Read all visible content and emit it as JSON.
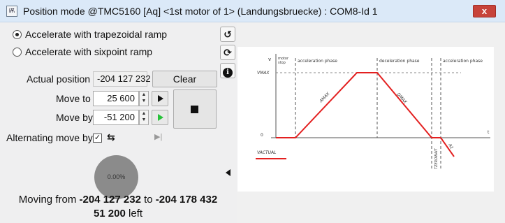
{
  "window": {
    "title": "Position mode @TMC5160 [Aq] <1st motor of 1> (Landungsbruecke) : COM8-Id 1",
    "close_label": "x",
    "icon_text": "Ѭ"
  },
  "ramp": {
    "option1": "Accelerate with trapezoidal ramp",
    "option2": "Accelerate with sixpoint ramp",
    "selected": "trapezoidal"
  },
  "side_buttons": {
    "undo_glyph": "↺",
    "refresh_glyph": "⟳",
    "info_glyph": "i"
  },
  "position": {
    "actual_label": "Actual position",
    "actual_value": "-204 127 232",
    "clear_label": "Clear",
    "move_to_label": "Move to",
    "move_to_value": "25 600",
    "move_by_label": "Move by",
    "move_by_value": "-51 200",
    "spin_up": "▲",
    "spin_down": "▼"
  },
  "alternating": {
    "label": "Alternating move by",
    "checked_glyph": "✓",
    "swap_glyph": "⇆",
    "skip_glyph": "▶|"
  },
  "progress": {
    "percent_label": "0.00%",
    "fraction": 0.0
  },
  "status": {
    "prefix": "Moving from",
    "from": "-204 127 232",
    "to_word": "to",
    "to": "-204 178 432",
    "remaining": "51 200",
    "suffix": "left"
  },
  "diagram": {
    "v_label": "v",
    "motor_stop": "motor\nstop",
    "accel_phase": "acceleration phase",
    "decel_phase": "deceleration phase",
    "accel_phase2": "acceleration phase",
    "vmax": "VMAX",
    "zero": "0",
    "t": "t",
    "amax": "AMAX",
    "dmax": "DMAX",
    "a1": "A1",
    "tzerowait": "TZEROWAIT",
    "vactual": "VACTUAL",
    "colors": {
      "ramp": "#e32020",
      "axis": "#555555"
    }
  }
}
